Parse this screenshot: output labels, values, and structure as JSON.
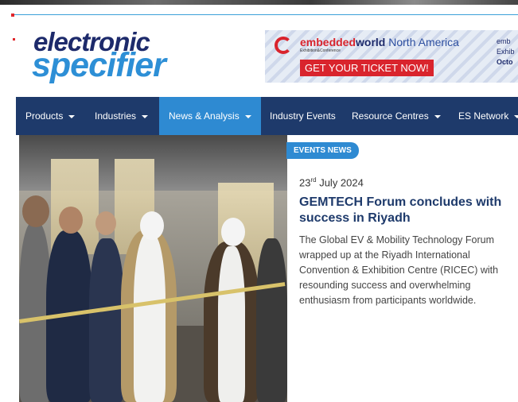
{
  "site": {
    "logo_line1": "electronic",
    "logo_line2": "specifier"
  },
  "banner": {
    "brand_part1": "embedded",
    "brand_part2": "world",
    "brand_part3": " North America",
    "subtitle": "Exhibition&Conference",
    "cta": "GET YOUR TICKET NOW!",
    "side_line1": "emb",
    "side_line2": "Exhib",
    "side_line3": "Octo"
  },
  "nav": {
    "items": [
      {
        "label": "Products",
        "has_dropdown": true,
        "active": false
      },
      {
        "label": "Industries",
        "has_dropdown": true,
        "active": false
      },
      {
        "label": "News & Analysis",
        "has_dropdown": true,
        "active": true
      },
      {
        "label": "Industry Events",
        "has_dropdown": false,
        "active": false
      },
      {
        "label": "Resource Centres",
        "has_dropdown": true,
        "active": false
      },
      {
        "label": "ES Network",
        "has_dropdown": true,
        "active": false
      }
    ]
  },
  "article": {
    "category": "EVENTS NEWS",
    "date_day": "23",
    "date_suffix": "rd",
    "date_rest": " July 2024",
    "title": "GEMTECH Forum concludes with success in Riyadh",
    "summary": "The Global EV & Mobility Technology Forum wrapped up at the Riyadh International Convention & Exhibition Centre (RICEC) with resounding success and overwhelming enthusiasm from participants worldwide."
  },
  "colors": {
    "nav_bg": "#1e3a6b",
    "nav_active": "#2e8ad2",
    "brand_red": "#d9242d",
    "logo_dark": "#1d2a6b",
    "logo_blue": "#2d8fd6"
  }
}
